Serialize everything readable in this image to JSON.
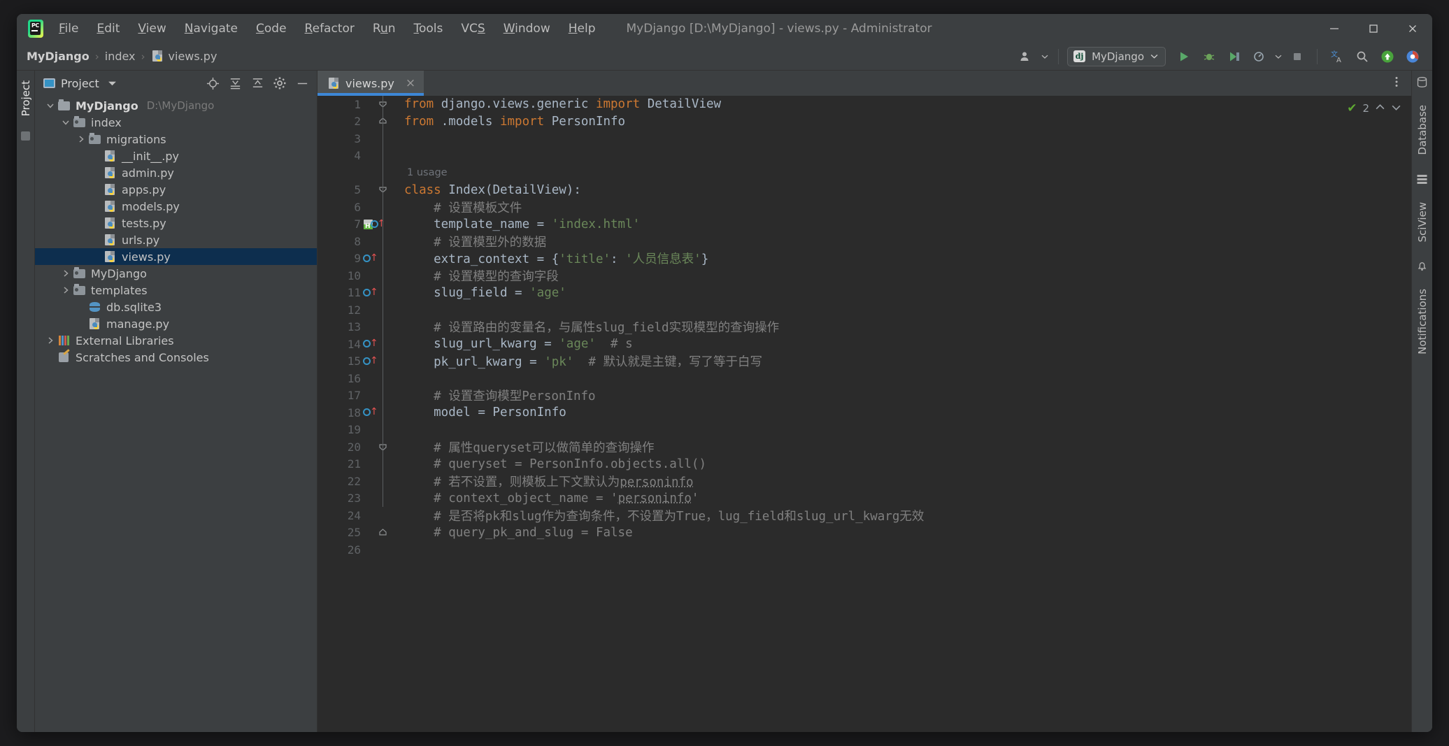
{
  "window": {
    "title": "MyDjango [D:\\MyDjango] - views.py - Administrator",
    "minimize": "minimize-button",
    "maximize": "maximize-button",
    "close": "close-button"
  },
  "menu": [
    {
      "label": "File",
      "mnemonic": "F"
    },
    {
      "label": "Edit",
      "mnemonic": "E"
    },
    {
      "label": "View",
      "mnemonic": "V"
    },
    {
      "label": "Navigate",
      "mnemonic": "N"
    },
    {
      "label": "Code",
      "mnemonic": "C"
    },
    {
      "label": "Refactor",
      "mnemonic": "R"
    },
    {
      "label": "Run",
      "mnemonic": "u"
    },
    {
      "label": "Tools",
      "mnemonic": "T"
    },
    {
      "label": "VCS",
      "mnemonic": "S"
    },
    {
      "label": "Window",
      "mnemonic": "W"
    },
    {
      "label": "Help",
      "mnemonic": "H"
    }
  ],
  "breadcrumb": {
    "items": [
      "MyDjango",
      "index",
      "views.py"
    ],
    "separator": "›"
  },
  "toolbar": {
    "run_config": "MyDjango",
    "run_config_icon": "django-icon",
    "icons": [
      "user-account-icon",
      "run-icon",
      "debug-icon",
      "run-coverage-icon",
      "profile-icon",
      "stop-icon",
      "translate-icon",
      "search-icon",
      "update-icon",
      "browser-icon"
    ]
  },
  "left_strip": {
    "tab": "Project",
    "icon": "project-square-icon"
  },
  "right_strip": {
    "tabs": [
      "Database",
      "SciView",
      "Notifications"
    ]
  },
  "project_panel": {
    "title": "Project",
    "dropdown_icon": "chevron-down-icon",
    "header_icons": [
      "locate-icon",
      "expand-all-icon",
      "collapse-all-icon",
      "settings-gear-icon",
      "hide-icon"
    ],
    "tree": [
      {
        "label": "MyDjango",
        "path": "D:\\MyDjango",
        "indent": 0,
        "chev": "down",
        "icon": "folder",
        "bold": true,
        "selected": false
      },
      {
        "label": "index",
        "path": "",
        "indent": 1,
        "chev": "down",
        "icon": "folder-src",
        "bold": false,
        "selected": false
      },
      {
        "label": "migrations",
        "path": "",
        "indent": 2,
        "chev": "right",
        "icon": "folder-src",
        "bold": false,
        "selected": false
      },
      {
        "label": "__init__.py",
        "path": "",
        "indent": 3,
        "chev": "none",
        "icon": "python",
        "bold": false,
        "selected": false
      },
      {
        "label": "admin.py",
        "path": "",
        "indent": 3,
        "chev": "none",
        "icon": "python",
        "bold": false,
        "selected": false
      },
      {
        "label": "apps.py",
        "path": "",
        "indent": 3,
        "chev": "none",
        "icon": "python",
        "bold": false,
        "selected": false
      },
      {
        "label": "models.py",
        "path": "",
        "indent": 3,
        "chev": "none",
        "icon": "python",
        "bold": false,
        "selected": false
      },
      {
        "label": "tests.py",
        "path": "",
        "indent": 3,
        "chev": "none",
        "icon": "python",
        "bold": false,
        "selected": false
      },
      {
        "label": "urls.py",
        "path": "",
        "indent": 3,
        "chev": "none",
        "icon": "python",
        "bold": false,
        "selected": false
      },
      {
        "label": "views.py",
        "path": "",
        "indent": 3,
        "chev": "none",
        "icon": "python",
        "bold": false,
        "selected": true
      },
      {
        "label": "MyDjango",
        "path": "",
        "indent": 1,
        "chev": "right",
        "icon": "folder-src",
        "bold": false,
        "selected": false
      },
      {
        "label": "templates",
        "path": "",
        "indent": 1,
        "chev": "right",
        "icon": "folder-src",
        "bold": false,
        "selected": false
      },
      {
        "label": "db.sqlite3",
        "path": "",
        "indent": 2,
        "chev": "none",
        "icon": "database",
        "bold": false,
        "selected": false
      },
      {
        "label": "manage.py",
        "path": "",
        "indent": 2,
        "chev": "none",
        "icon": "python",
        "bold": false,
        "selected": false
      },
      {
        "label": "External Libraries",
        "path": "",
        "indent": 0,
        "chev": "right",
        "icon": "library",
        "bold": false,
        "selected": false
      },
      {
        "label": "Scratches and Consoles",
        "path": "",
        "indent": 0,
        "chev": "none",
        "icon": "scratch",
        "bold": false,
        "selected": false
      }
    ]
  },
  "editor": {
    "tab": {
      "label": "views.py",
      "icon": "python-file-icon",
      "close": "×"
    },
    "more_icon": "more-vertical-icon",
    "inspection": {
      "count": "2",
      "check_icon": "check-icon",
      "up_icon": "chevron-up-icon",
      "down_icon": "chevron-down-icon"
    },
    "usage_hint": "1 usage",
    "lines": [
      {
        "n": "1",
        "marker": "",
        "fold": "open",
        "html": "<span class=\"kw\">from</span> django.views.generic <span class=\"kw\">import</span> DetailView"
      },
      {
        "n": "2",
        "marker": "",
        "fold": "end",
        "html": "<span class=\"kw\">from</span> .models <span class=\"kw\">import</span> PersonInfo"
      },
      {
        "n": "3",
        "marker": "",
        "fold": "",
        "html": ""
      },
      {
        "n": "4",
        "marker": "",
        "fold": "",
        "html": ""
      },
      {
        "n": "",
        "marker": "",
        "fold": "",
        "html": "",
        "usage": "1 usage"
      },
      {
        "n": "5",
        "marker": "",
        "fold": "open",
        "html": "<span class=\"kw\">class</span> Index(DetailView):"
      },
      {
        "n": "6",
        "marker": "",
        "fold": "",
        "html": "    <span class=\"cm\"># 设置模板文件</span>"
      },
      {
        "n": "7",
        "marker": "html+override",
        "fold": "",
        "html": "    template_name = <span class=\"str\">'index.html'</span>"
      },
      {
        "n": "8",
        "marker": "",
        "fold": "",
        "html": "    <span class=\"cm\"># 设置模型外的数据</span>"
      },
      {
        "n": "9",
        "marker": "override",
        "fold": "",
        "html": "    extra_context = {<span class=\"str\">'title'</span>: <span class=\"str\">'人员信息表'</span>}"
      },
      {
        "n": "10",
        "marker": "",
        "fold": "",
        "html": "    <span class=\"cm\"># 设置模型的查询字段</span>"
      },
      {
        "n": "11",
        "marker": "override",
        "fold": "",
        "html": "    slug_field = <span class=\"str\">'age'</span>"
      },
      {
        "n": "12",
        "marker": "",
        "fold": "",
        "html": ""
      },
      {
        "n": "13",
        "marker": "",
        "fold": "",
        "html": "    <span class=\"cm\"># 设置路由的变量名，与属性slug_field实现模型的查询操作</span>"
      },
      {
        "n": "14",
        "marker": "override",
        "fold": "",
        "html": "    slug_url_kwarg = <span class=\"str\">'age'</span>  <span class=\"cm\"># s</span>"
      },
      {
        "n": "15",
        "marker": "override",
        "fold": "",
        "html": "    pk_url_kwarg = <span class=\"str\">'pk'</span>  <span class=\"cm\"># 默认就是主键，写了等于白写</span>"
      },
      {
        "n": "16",
        "marker": "",
        "fold": "",
        "html": ""
      },
      {
        "n": "17",
        "marker": "",
        "fold": "",
        "html": "    <span class=\"cm\"># 设置查询模型PersonInfo</span>"
      },
      {
        "n": "18",
        "marker": "override",
        "fold": "",
        "html": "    model = PersonInfo"
      },
      {
        "n": "19",
        "marker": "",
        "fold": "",
        "html": ""
      },
      {
        "n": "20",
        "marker": "",
        "fold": "open2",
        "html": "    <span class=\"cm\"># 属性queryset可以做简单的查询操作</span>"
      },
      {
        "n": "21",
        "marker": "",
        "fold": "",
        "html": "    <span class=\"cm\"># queryset = PersonInfo.objects.all()</span>"
      },
      {
        "n": "22",
        "marker": "",
        "fold": "",
        "html": "    <span class=\"cm\"># 若不设置，则模板上下文默认为</span><span class=\"cm squig\">personinfo</span>"
      },
      {
        "n": "23",
        "marker": "",
        "fold": "",
        "html": "    <span class=\"cm\"># context_object_name = '</span><span class=\"cm squig\">personinfo</span><span class=\"cm\">'</span>"
      },
      {
        "n": "24",
        "marker": "",
        "fold": "",
        "html": "    <span class=\"cm\"># 是否将pk和slug作为查询条件，不设置为True，lug_field和slug_url_kwarg无效</span>"
      },
      {
        "n": "25",
        "marker": "",
        "fold": "close",
        "html": "    <span class=\"cm\"># query_pk_and_slug = False</span>"
      },
      {
        "n": "26",
        "marker": "",
        "fold": "",
        "html": ""
      }
    ]
  }
}
